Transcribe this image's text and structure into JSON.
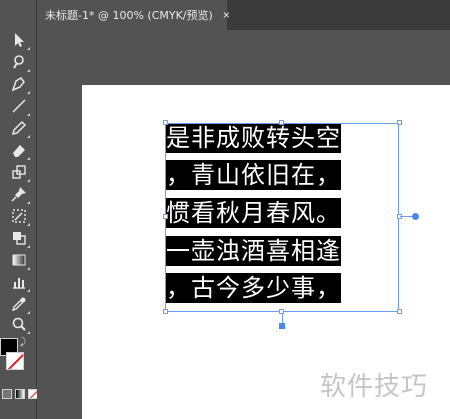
{
  "tab": {
    "title": "未标题-1* @ 100% (CMYK/预览)",
    "close": "×"
  },
  "tools": [
    {
      "name": "selection-tool-icon"
    },
    {
      "name": "magic-wand-icon"
    },
    {
      "name": "pen-tool-icon"
    },
    {
      "name": "line-tool-icon"
    },
    {
      "name": "pencil-tool-icon"
    },
    {
      "name": "eraser-tool-icon"
    },
    {
      "name": "rotate-tool-icon"
    },
    {
      "name": "pin-tool-icon"
    },
    {
      "name": "free-transform-icon"
    },
    {
      "name": "shape-builder-icon"
    },
    {
      "name": "gradient-tool-icon"
    },
    {
      "name": "blend-tool-icon"
    },
    {
      "name": "graph-tool-icon"
    },
    {
      "name": "eyedropper-tool-icon"
    },
    {
      "name": "zoom-tool-icon"
    }
  ],
  "colors": {
    "fill": "#000000",
    "stroke": "#ffffff",
    "selection": "#6b9cf0"
  },
  "text_lines": [
    "是非成败转头空",
    "，青山依旧在，",
    "惯看秋月春风。",
    "一壶浊酒喜相逢",
    "，古今多少事，"
  ],
  "watermark": "软件技巧"
}
